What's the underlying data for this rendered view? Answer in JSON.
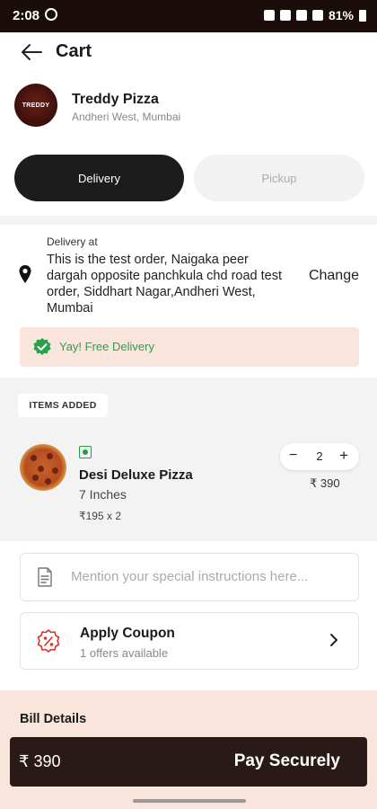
{
  "status_bar": {
    "time": "2:08",
    "battery": "81%"
  },
  "header": {
    "title": "Cart"
  },
  "restaurant": {
    "name": "Treddy Pizza",
    "location": "Andheri West, Mumbai",
    "logo_text": "TREDDY"
  },
  "order_type": {
    "delivery_label": "Delivery",
    "pickup_label": "Pickup",
    "selected": "Delivery"
  },
  "address": {
    "label": "Delivery at",
    "text": "This is the test order, Naigaka peer dargah opposite panchkula chd road test order, Siddhart Nagar,Andheri West, Mumbai",
    "change_label": "Change"
  },
  "free_delivery": {
    "text": "Yay! Free Delivery"
  },
  "items": {
    "section_label": "ITEMS ADDED",
    "list": [
      {
        "name": "Desi Deluxe Pizza",
        "size": "7 Inches",
        "calc": "₹195 x 2",
        "quantity": "2",
        "price": "₹ 390",
        "veg": true
      }
    ]
  },
  "instructions": {
    "placeholder": "Mention your special instructions here..."
  },
  "coupon": {
    "title": "Apply Coupon",
    "subtitle": "1 offers available"
  },
  "bill": {
    "title": "Bill Details"
  },
  "pay_bar": {
    "amount": "₹ 390",
    "button_label": "Pay Securely"
  },
  "colors": {
    "primary_dark": "#1c1c1c",
    "accent_green": "#2aa24a",
    "banner_bg": "#f9e5dc",
    "coupon_red": "#d9342b",
    "pay_bar_bg": "#2a1a17"
  },
  "icons": {
    "back": "arrow-left-icon",
    "pin": "location-pin-icon",
    "check": "check-badge-icon",
    "doc": "document-icon",
    "coupon": "coupon-percent-icon",
    "chevron": "chevron-right-icon"
  }
}
